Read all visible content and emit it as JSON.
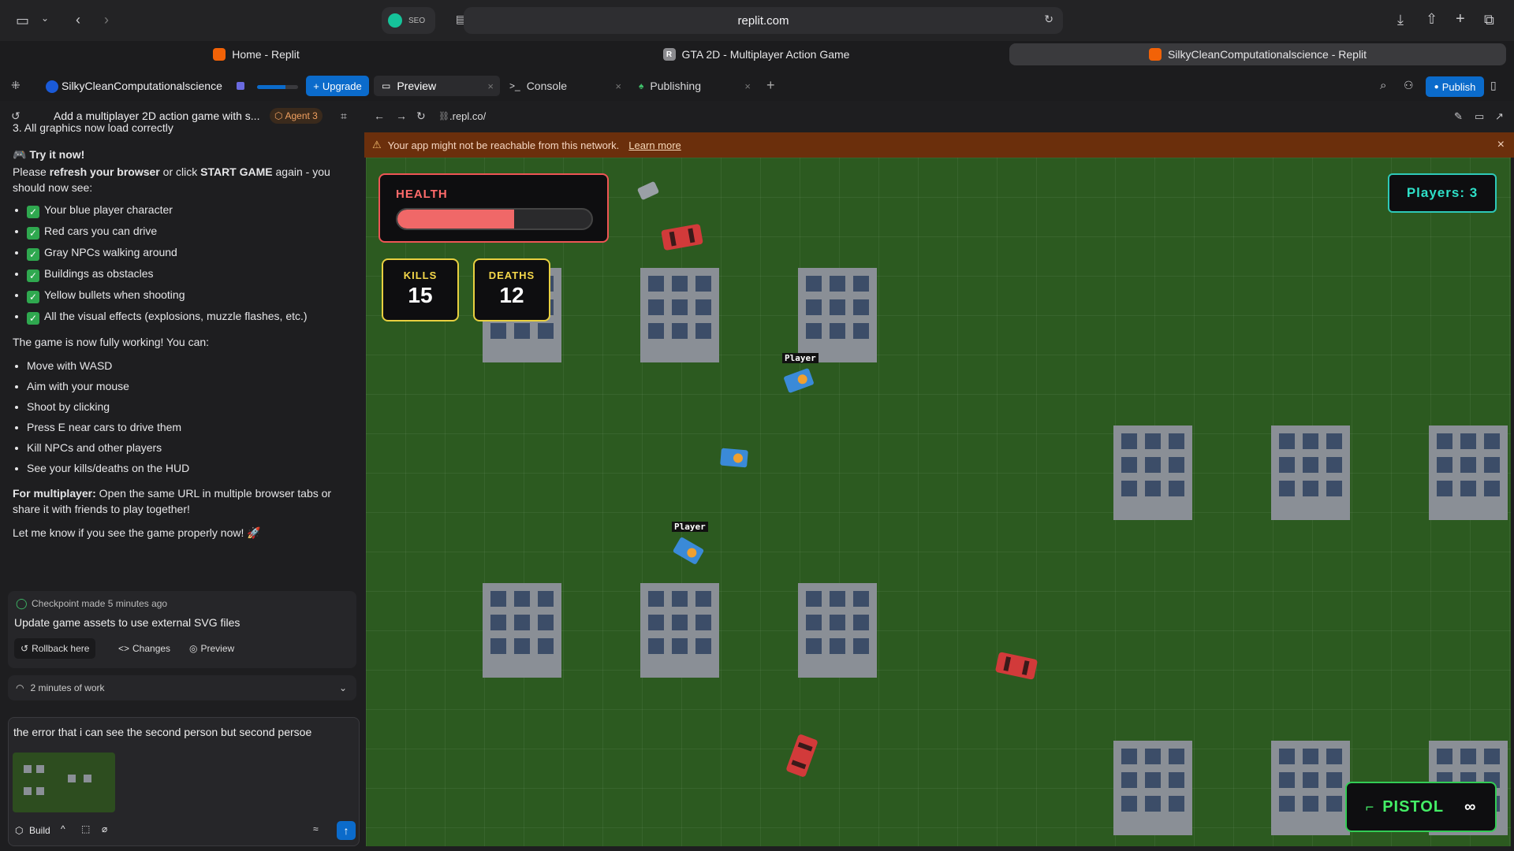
{
  "browser": {
    "url": "replit.com",
    "ext_label": "SEO",
    "tabs": [
      {
        "label": "Home - Replit"
      },
      {
        "label": "GTA 2D - Multiplayer Action Game"
      },
      {
        "label": "SilkyCleanComputationalscience - Replit"
      }
    ]
  },
  "replit": {
    "project_name": "SilkyCleanComputationalscience",
    "upgrade_label": "Upgrade",
    "tabs": [
      {
        "label": "Preview"
      },
      {
        "label": "Console"
      },
      {
        "label": "Publishing"
      }
    ],
    "publish_label": "Publish"
  },
  "chat": {
    "title": "Add a multiplayer 2D action game with s...",
    "agent_badge": "Agent 3",
    "line_top": "3.  All graphics now load correctly",
    "try_heading": "Try it now!",
    "try_body_1": "Please ",
    "try_bold_1": "refresh your browser",
    "try_body_2": " or click ",
    "try_bold_2": "START GAME",
    "try_body_3": " again - you should now see:",
    "see_items": [
      "Your blue player character",
      "Red cars you can drive",
      "Gray NPCs walking around",
      "Buildings as obstacles",
      "Yellow bullets when shooting",
      "All the visual effects (explosions, muzzle flashes, etc.)"
    ],
    "working_text": "The game is now fully working! You can:",
    "can_items": [
      "Move with WASD",
      "Aim with your mouse",
      "Shoot by clicking",
      "Press E near cars to drive them",
      "Kill NPCs and other players",
      "See your kills/deaths on the HUD"
    ],
    "multi_bold": "For multiplayer:",
    "multi_text": " Open the same URL in multiple browser tabs or share it with friends to play together!",
    "closing": "Let me know if you see the game properly now! 🚀",
    "checkpoint_meta": "Checkpoint made 5 minutes ago",
    "checkpoint_title": "Update game assets to use external SVG files",
    "rollback_label": "Rollback here",
    "changes_label": "Changes",
    "preview_label": "Preview",
    "work_label": "2 minutes of work",
    "input_text": "the error that i can see the second person but second persoe",
    "build_label": "Build"
  },
  "preview": {
    "url": ".repl.co/",
    "warning": "Your app might not be reachable from this network.",
    "learn_more": "Learn more"
  },
  "game": {
    "health_label": "HEALTH",
    "health_value": 0.6,
    "kills_label": "KILLS",
    "kills_value": "15",
    "deaths_label": "DEATHS",
    "deaths_value": "12",
    "players_label": "Players: 3",
    "weapon_label": "PISTOL",
    "ammo_label": "∞",
    "player_tag": "Player",
    "colors": {
      "grass": "#2c5a20",
      "building": "#8a8f96",
      "health": "#ee5555",
      "hud_yellow": "#e8d040",
      "players_teal": "#2ec8b8",
      "weapon_green": "#33cc55"
    }
  }
}
